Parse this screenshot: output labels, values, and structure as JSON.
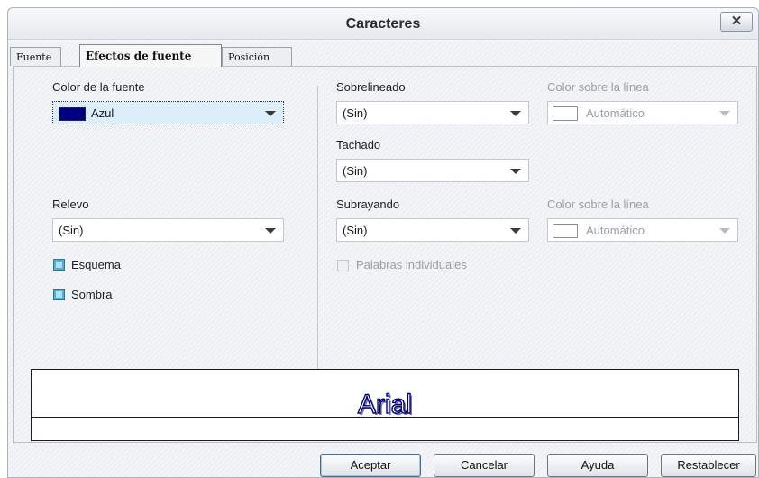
{
  "window": {
    "title": "Caracteres",
    "close_label": "✕"
  },
  "tabs": [
    {
      "label": "Fuente"
    },
    {
      "label": "Efectos de fuente",
      "active": true
    },
    {
      "label": "Posición"
    }
  ],
  "left": {
    "font_color": {
      "label": "Color de la fuente",
      "value": "Azul",
      "swatch": "#00007f"
    },
    "relief": {
      "label": "Relevo",
      "value": "(Sin)"
    },
    "outline": {
      "label": "Esquema"
    },
    "shadow": {
      "label": "Sombra"
    }
  },
  "right": {
    "overline": {
      "label": "Sobrelineado",
      "value": "(Sin)"
    },
    "overline_color": {
      "label": "Color sobre la línea",
      "value": "Automático"
    },
    "strikethrough": {
      "label": "Tachado",
      "value": "(Sin)"
    },
    "underline": {
      "label": "Subrayando",
      "value": "(Sin)"
    },
    "underline_color": {
      "label": "Color sobre la línea",
      "value": "Automático"
    },
    "individual_words": {
      "label": "Palabras individuales"
    }
  },
  "preview": {
    "text": "Arial"
  },
  "buttons": {
    "ok": "Aceptar",
    "cancel": "Cancelar",
    "help": "Ayuda",
    "reset": "Restablecer"
  },
  "colors": {
    "accent_blue": "#00007f",
    "checkbox_fill": "#4fb3d6"
  }
}
